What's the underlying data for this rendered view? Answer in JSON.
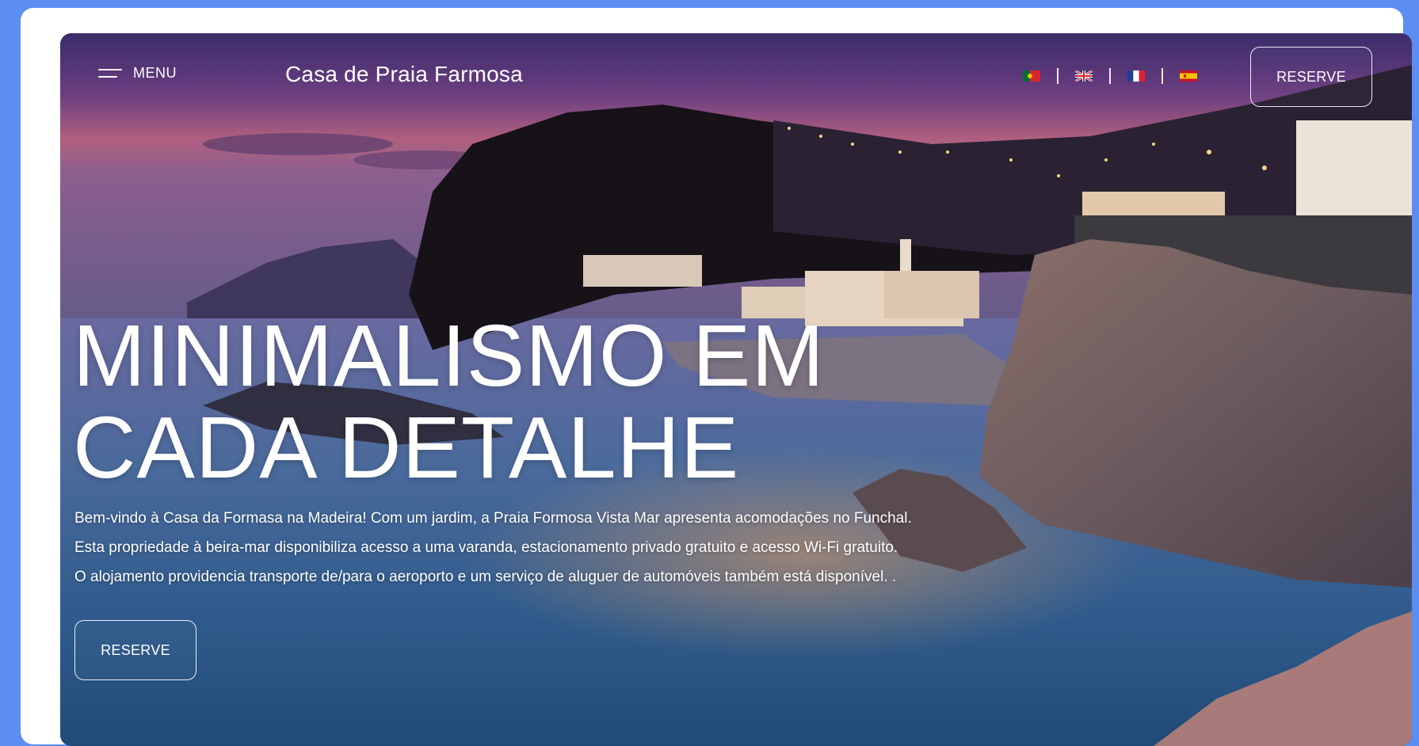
{
  "nav": {
    "menu_label": "MENU",
    "brand": "Casa de Praia Farmosa",
    "languages": [
      {
        "code": "pt",
        "icon": "portugal-flag-icon"
      },
      {
        "code": "en",
        "icon": "uk-flag-icon"
      },
      {
        "code": "fr",
        "icon": "france-flag-icon"
      },
      {
        "code": "es",
        "icon": "spain-flag-icon"
      }
    ],
    "reserve_label": "RESERVE"
  },
  "hero": {
    "headline_line1": "MINIMALISMO EM",
    "headline_line2": "CADA DETALHE",
    "intro_lines": [
      "Bem-vindo à Casa da Formasa na Madeira! Com um jardim, a Praia Formosa Vista Mar apresenta acomodações no Funchal.",
      "Esta propriedade à beira-mar disponibiliza acesso a uma varanda, estacionamento privado gratuito e acesso Wi-Fi gratuito.",
      "O alojamento providencia transporte de/para o aeroporto e um serviço de aluguer de automóveis também está disponível. ."
    ],
    "reserve_label": "RESERVE",
    "background_image": "coastal-village-at-dusk"
  },
  "colors": {
    "page_background": "#5b8ef0",
    "text": "#ffffff"
  }
}
